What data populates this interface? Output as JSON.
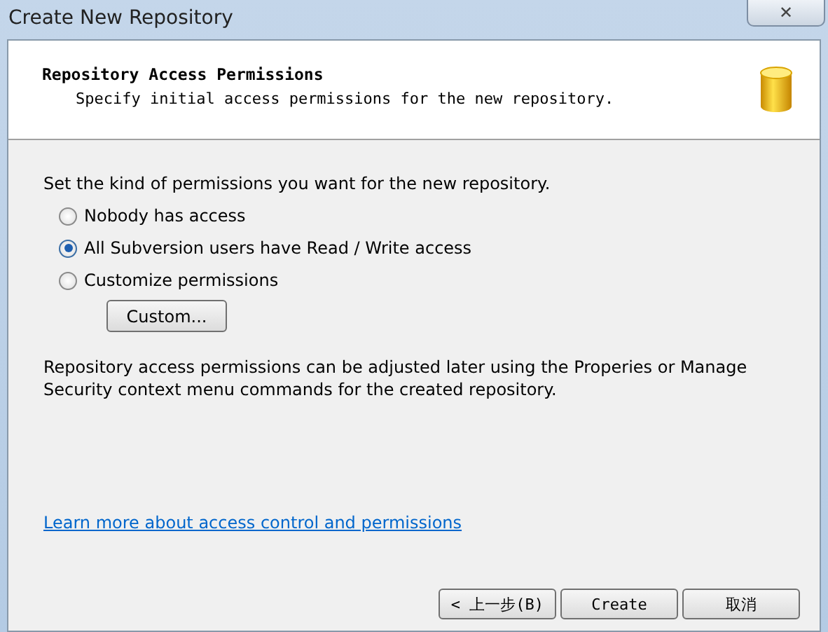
{
  "window": {
    "title": "Create New Repository",
    "close": "✕"
  },
  "header": {
    "title": "Repository Access Permissions",
    "subtitle": "Specify initial access permissions for the new repository."
  },
  "prompt": "Set the kind of permissions you want for the new repository.",
  "options": [
    {
      "label": "Nobody has access",
      "selected": false
    },
    {
      "label": "All Subversion users have Read / Write access",
      "selected": true
    },
    {
      "label": "Customize permissions",
      "selected": false
    }
  ],
  "custom_button": "Custom...",
  "note": "Repository access permissions can be adjusted later using the Properies or Manage Security context menu commands for the created repository.",
  "link": "Learn more about access control and permissions",
  "buttons": [
    "< 上一步(B)",
    "Create",
    "取消"
  ]
}
